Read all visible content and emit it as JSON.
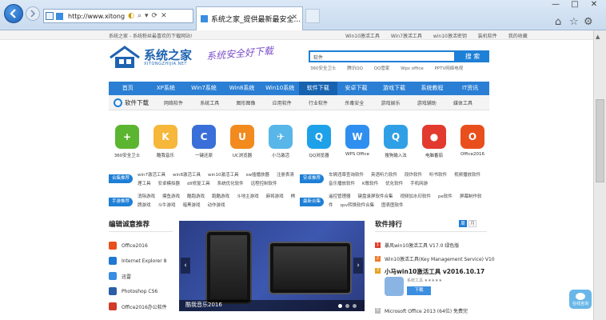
{
  "browser": {
    "url": "http://www.xitong",
    "tab_title": "系统之家_提供最新最安全...",
    "window_controls": {
      "minimize": "—",
      "maximize": "□",
      "close": "✕"
    }
  },
  "topbar": {
    "left": "系统之家 - 系统粉丝最喜欢的下载网站!",
    "links": [
      "Win10激活工具",
      "Win7激活工具",
      "win10激活密钥",
      "装机软件",
      "我的收藏"
    ]
  },
  "header": {
    "logo_text": "系统之家",
    "logo_sub": "XITONGZHIJIA.NET",
    "slogan": "系统安全好下载",
    "search_placeholder": "软件",
    "search_button": "搜 索",
    "hot": [
      "360安全卫士",
      "腾讯QQ",
      "QQ管家",
      "Wps office",
      "PPTV网络电视"
    ]
  },
  "nav": [
    "首页",
    "XP系统",
    "Win7系统",
    "Win8系统",
    "Win10系统",
    "软件下载",
    "安卓下载",
    "游戏下载",
    "系统教程",
    "IT资讯"
  ],
  "nav_active": 5,
  "subnav": {
    "title": "软件下载",
    "items": [
      "网络软件",
      "系统工具",
      "图形图像",
      "应用软件",
      "行业软件",
      "杀毒安全",
      "游戏娱乐",
      "游戏辅助",
      "媒体工具"
    ]
  },
  "apps": [
    {
      "name": "360安全卫士",
      "color": "#5cb531",
      "glyph": "+"
    },
    {
      "name": "酷我音乐",
      "color": "#f6b73a",
      "glyph": "K"
    },
    {
      "name": "一键还原",
      "color": "#3a6fd9",
      "glyph": "C"
    },
    {
      "name": "UC浏览器",
      "color": "#f28a1e",
      "glyph": "U"
    },
    {
      "name": "小马激活",
      "color": "#58b6e8",
      "glyph": "✈"
    },
    {
      "name": "QQ浏览器",
      "color": "#1ea1e8",
      "glyph": "Q"
    },
    {
      "name": "WPS Office",
      "color": "#2f8ff0",
      "glyph": "W"
    },
    {
      "name": "搜狗输入法",
      "color": "#2fa0e6",
      "glyph": "Q"
    },
    {
      "name": "电脑番茄",
      "color": "#e23a2f",
      "glyph": "●"
    },
    {
      "name": "Office2016",
      "color": "#e84f1c",
      "glyph": "O"
    }
  ],
  "categories": [
    {
      "tag": "合集推荐",
      "left": [
        "win7激活工具",
        "win8激活工具",
        "win10激活工具",
        "sw插播放器",
        "注册表清理工具",
        "安卓模拟器",
        "dll修复工具",
        "系统优化软件",
        "远程控制软件"
      ],
      "right_tag": "安卓推荐",
      "right": [
        "车辆违章查询软件",
        "英语听力软件",
        "段炸软件",
        "听书软件",
        "视频播放软件",
        "音乐播放软件",
        "K歌软件",
        "优化软件",
        "手机网游"
      ]
    },
    {
      "tag": "手游推荐",
      "left": [
        "消除游戏",
        "摸鱼游戏",
        "酷跑游戏",
        "跑酷游戏",
        "斗地主游戏",
        "麻将游戏",
        "棋牌游戏",
        "斗牛游戏",
        "暗黑游戏",
        "动作游戏"
      ],
      "right_tag": "最新合集",
      "right": [
        "遥控管理器",
        "键盘录屏软件合集",
        "视频加水印软件",
        "pe软件",
        "屏幕制作软件",
        "qsv转换软件合集",
        "图表图软件"
      ]
    }
  ],
  "editor": {
    "title": "编辑诚意推荐",
    "items": [
      {
        "name": "Office2016",
        "color": "#e84f1c"
      },
      {
        "name": "Internet Explorer 8",
        "color": "#1f78d1"
      },
      {
        "name": "迅雷",
        "color": "#3a8de0"
      },
      {
        "name": "Photoshop CS6",
        "color": "#2a5fa8"
      },
      {
        "name": "Office2016办公软件",
        "color": "#d23a2a"
      }
    ]
  },
  "slider": {
    "caption": "酷我音乐2016",
    "prev": "‹",
    "next": "›"
  },
  "ranking": {
    "title": "软件排行",
    "tabs": [
      "周",
      "月"
    ],
    "items": [
      {
        "num": "1",
        "name": "暴风win10激活工具 V17.0 绿色版"
      },
      {
        "num": "2",
        "name": "Win10激活工具(Key Management Service) V10"
      },
      {
        "num": "3",
        "name": ""
      }
    ],
    "featured": {
      "name": "小马win10激活工具 v2016.10.17",
      "category": "系统工具 ★★★★★",
      "download": "下载"
    },
    "last": {
      "num": "5",
      "name": "Microsoft Office 2013 (64位) 免费完"
    }
  },
  "chat_label": "在线咨询"
}
